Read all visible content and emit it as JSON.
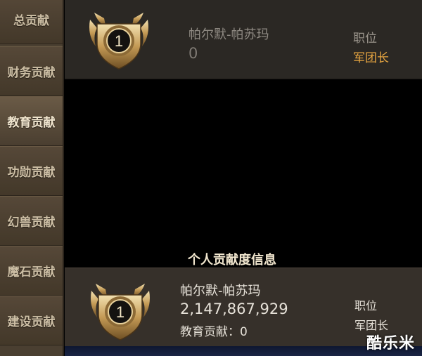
{
  "sidebar": {
    "items": [
      {
        "label": "总贡献"
      },
      {
        "label": "财务贡献"
      },
      {
        "label": "教育贡献"
      },
      {
        "label": "功勋贡献"
      },
      {
        "label": "幻兽贡献"
      },
      {
        "label": "魔石贡献"
      },
      {
        "label": "建设贡献"
      }
    ],
    "active_index": 2
  },
  "top_card": {
    "rank": "1",
    "player_name": "帕尔默-帕苏玛",
    "value": "0",
    "position_label": "职位",
    "position_value": "军团长"
  },
  "personal_section": {
    "title": "个人贡献度信息"
  },
  "bottom_card": {
    "rank": "1",
    "player_name": "帕尔默-帕苏玛",
    "power": "2,147,867,929",
    "contribution": "教育贡献：0",
    "position_label": "职位",
    "position_value": "军团长"
  },
  "watermark": "酷乐米",
  "colors": {
    "gold": "#e7a641",
    "sidebar_bg": "#4a3f31"
  }
}
